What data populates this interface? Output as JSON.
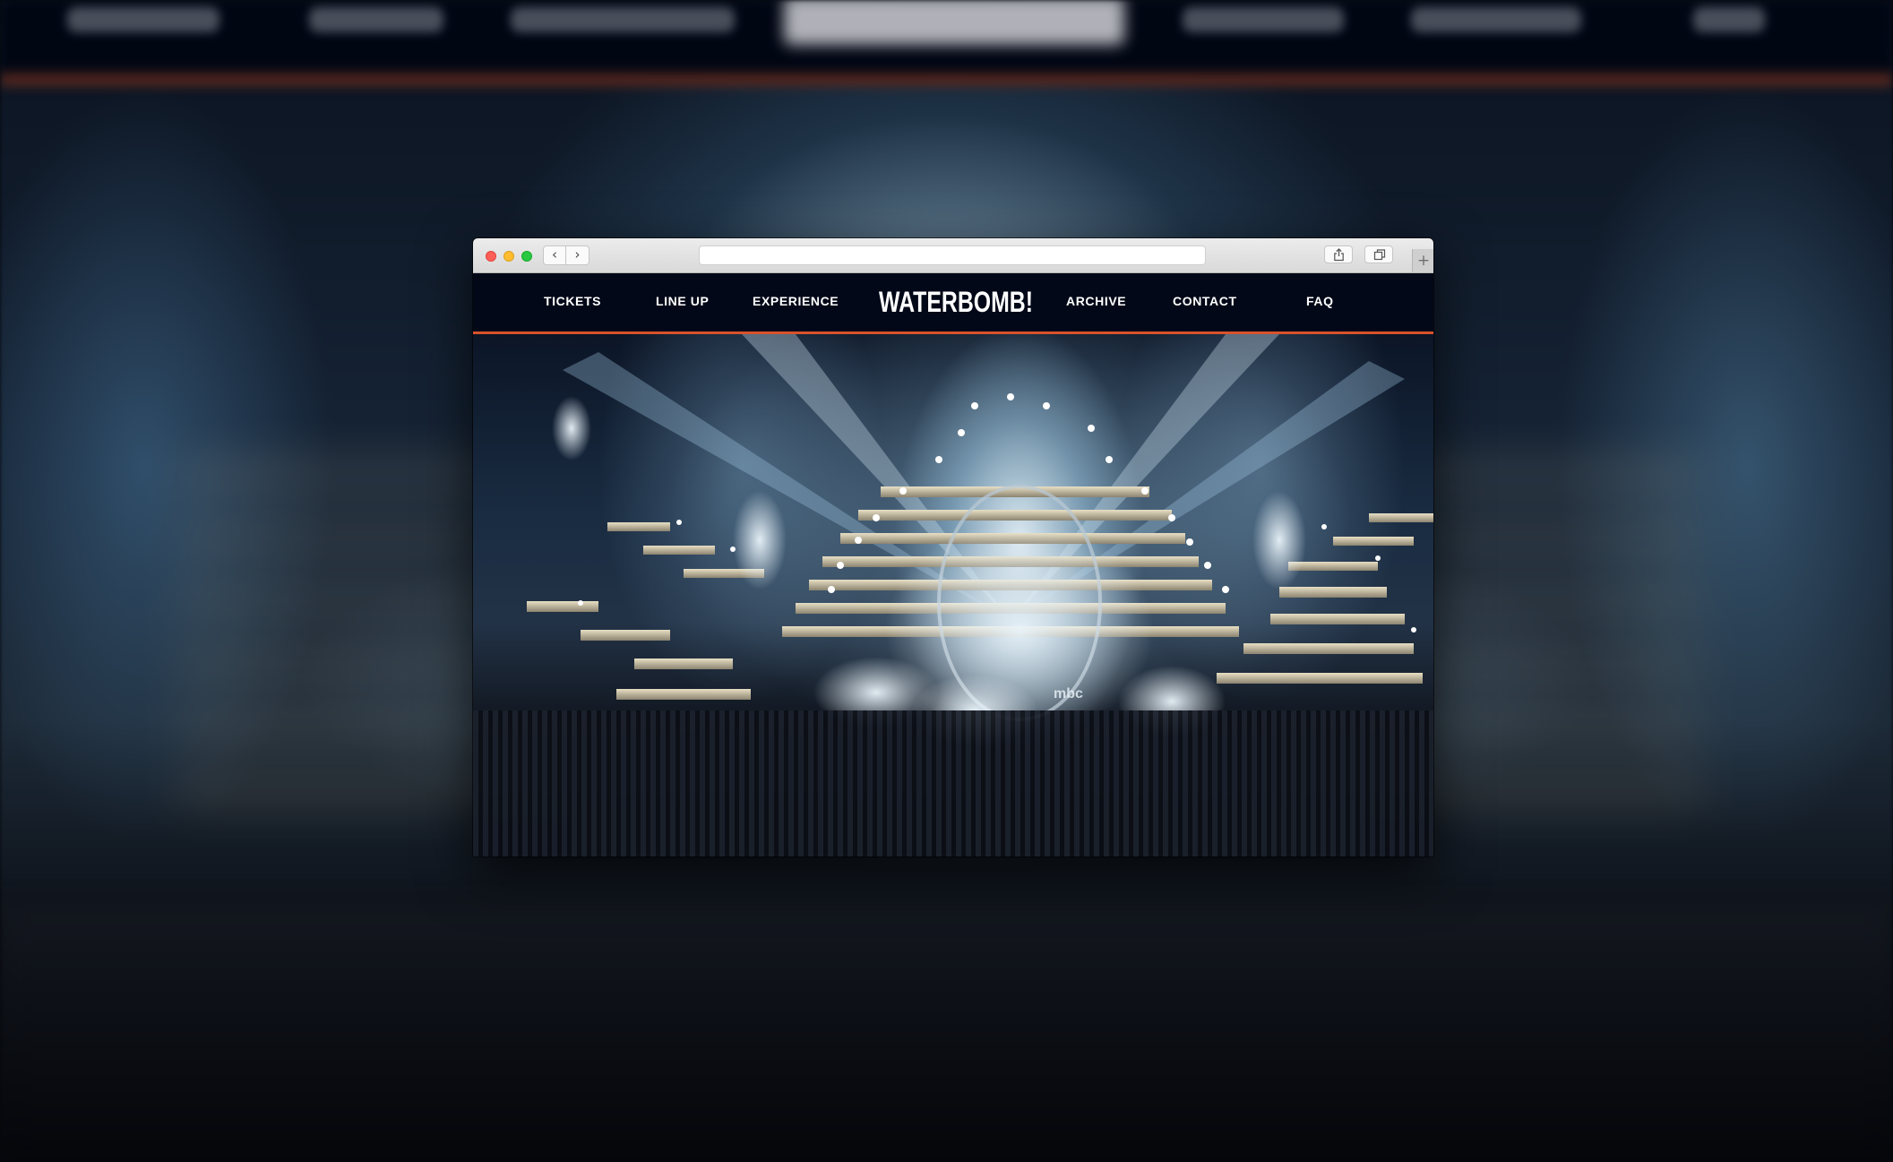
{
  "browser": {
    "back_icon": "‹",
    "forward_icon": "›",
    "new_tab_icon": "+",
    "icons": [
      "close-icon",
      "minimize-icon",
      "zoom-icon",
      "chevron-left-icon",
      "chevron-right-icon",
      "share-icon",
      "tabs-overview-icon",
      "plus-icon"
    ]
  },
  "site": {
    "nav": {
      "tickets": "TICKETS",
      "line_up": "LINE UP",
      "experience": "EXPERIENCE",
      "archive": "ARCHIVE",
      "contact": "CONTACT",
      "faq": "FAQ"
    },
    "logo": "WATERBOMB!",
    "hero": {
      "stage_marker": "mbc"
    }
  },
  "colors": {
    "nav_background": "#020817",
    "nav_accent_line": "#d7532c",
    "nav_text": "#ffffff"
  }
}
